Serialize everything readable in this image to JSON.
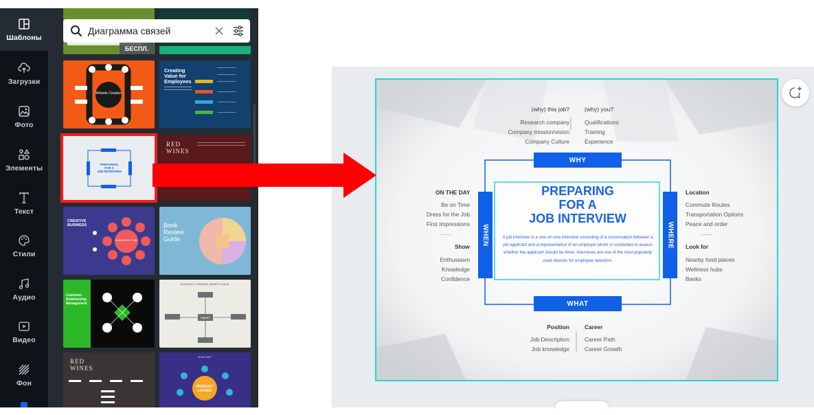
{
  "nav": {
    "items": [
      {
        "label": "Шаблоны",
        "icon": "templates-icon"
      },
      {
        "label": "Загрузки",
        "icon": "upload-cloud-icon"
      },
      {
        "label": "Фото",
        "icon": "photo-icon"
      },
      {
        "label": "Элементы",
        "icon": "elements-icon"
      },
      {
        "label": "Текст",
        "icon": "text-icon"
      },
      {
        "label": "Стили",
        "icon": "palette-icon"
      },
      {
        "label": "Аудио",
        "icon": "music-note-icon"
      },
      {
        "label": "Видео",
        "icon": "video-icon"
      },
      {
        "label": "Фон",
        "icon": "background-pattern-icon"
      }
    ]
  },
  "search": {
    "value": "Диаграмма связей"
  },
  "templates": {
    "badge": "БЕСПЛ.",
    "t1_title": "Creating Value for Employees",
    "t1_line1": "Creating",
    "t1_line2": "Value for",
    "t1_line3": "Employees",
    "t_website": "Website Creation",
    "t_red_wines_1": "RED",
    "t_red_wines_2": "WINES",
    "t_creative_1": "CREATIVE",
    "t_creative_2": "BUSINESS",
    "t_business_plan": "BUSINESS PLAN",
    "t_book_1": "Book",
    "t_book_2": "Review",
    "t_book_3": "Guide",
    "t_crm_1": "Customer",
    "t_crm_2": "Relationship",
    "t_crm_3": "Management",
    "t_smart": "WORKING TOWARDS SMART GOALS",
    "t_smart_center": "SMART",
    "t_product_1": "PRODUCT",
    "t_product_2": "LAUNCH",
    "t_mindmap": "MIND MAP",
    "t_preparing_1": "PREPARING",
    "t_preparing_2": "FOR A",
    "t_preparing_3": "JOB INTERVIEW"
  },
  "design": {
    "why_this_job": {
      "heading": "(why) this job?",
      "items": [
        "Research company",
        "Company mission/vision",
        "Company Culture"
      ]
    },
    "why_you": {
      "heading": "(why) you?",
      "items": [
        "Qualifications",
        "Training",
        "Experience"
      ]
    },
    "tabs": {
      "why": "WHY",
      "when": "WHEN",
      "where": "WHERE",
      "what": "WHAT"
    },
    "on_the_day": {
      "heading": "ON THE DAY",
      "items": [
        "Be on Time",
        "Dress for the Job",
        "First Impressions"
      ],
      "dots": "..........",
      "show_heading": "Show",
      "show_items": [
        "Enthusiasm",
        "Knowledge",
        "Confidence"
      ]
    },
    "location": {
      "heading": "Location",
      "items": [
        "Commute Routes",
        "Transportation Options",
        "Peace and order"
      ],
      "dots": "..........",
      "look_heading": "Look for",
      "look_items": [
        "Nearby food places",
        "Wellness hubs",
        "Banks"
      ]
    },
    "title_lines": [
      "PREPARING",
      "FOR A",
      "JOB INTERVIEW"
    ],
    "description": "A job interview is a one-on-one interview consisting of a conversation between a job applicant and a representative of an employer which is conducted to assess whether the applicant should be hired. Interviews are one of the most popularly used devices for employee selection.",
    "position": {
      "heading": "Position",
      "items": [
        "Job Description",
        "Job knowledge"
      ]
    },
    "career": {
      "heading": "Career",
      "items": [
        "Career Path",
        "Career Growth"
      ]
    }
  },
  "colors": {
    "rail_bg": "#0e1318",
    "panel_bg": "#252b33",
    "selection_red": "#ff1a1a",
    "arrow_red": "#ff0000",
    "design_blue": "#1060e8",
    "design_cyan": "#2ad0d8"
  }
}
